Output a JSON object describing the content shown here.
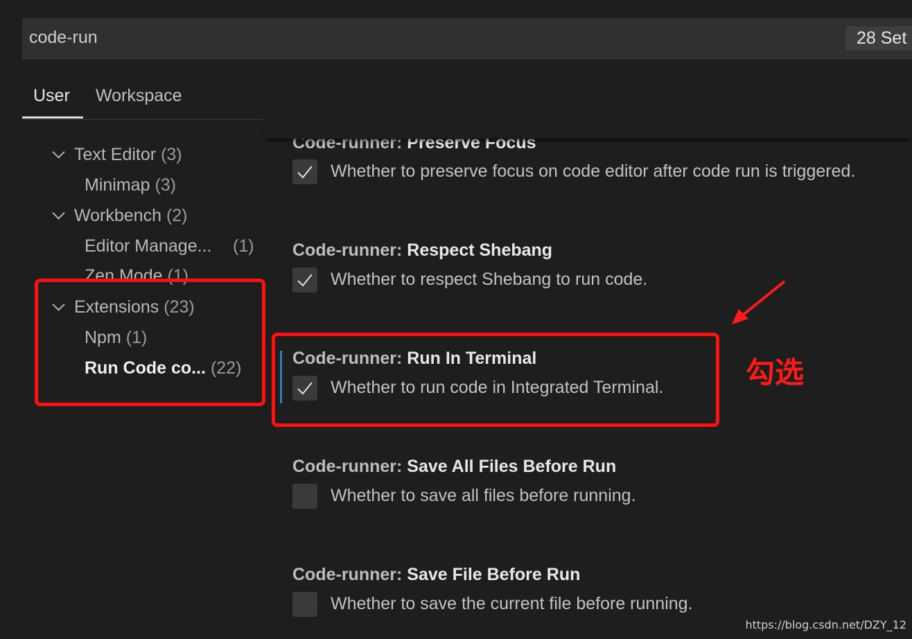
{
  "search": {
    "value": "code-run",
    "result_count": "28 Set"
  },
  "tabs": [
    {
      "label": "User"
    },
    {
      "label": "Workspace"
    }
  ],
  "toc": {
    "items": [
      {
        "label": "Text Editor",
        "count": "(3)"
      },
      {
        "label": "Minimap",
        "count": "(3)"
      },
      {
        "label": "Workbench",
        "count": "(2)"
      },
      {
        "label": "Editor Manage...",
        "count": "(1)"
      },
      {
        "label": "Zen Mode",
        "count": "(1)"
      },
      {
        "label": "Extensions",
        "count": "(23)"
      },
      {
        "label": "Npm",
        "count": "(1)"
      },
      {
        "label": "Run Code co...",
        "count": "(22)"
      }
    ]
  },
  "settings": [
    {
      "prefix": "Code-runner: ",
      "name": "Preserve Focus",
      "description": "Whether to preserve focus on code editor after code run is triggered.",
      "checked": true
    },
    {
      "prefix": "Code-runner: ",
      "name": "Respect Shebang",
      "description": "Whether to respect Shebang to run code.",
      "checked": true
    },
    {
      "prefix": "Code-runner: ",
      "name": "Run In Terminal",
      "description": "Whether to run code in Integrated Terminal.",
      "checked": true
    },
    {
      "prefix": "Code-runner: ",
      "name": "Save All Files Before Run",
      "description": "Whether to save all files before running.",
      "checked": false
    },
    {
      "prefix": "Code-runner: ",
      "name": "Save File Before Run",
      "description": "Whether to save the current file before running.",
      "checked": false
    }
  ],
  "annotation": {
    "text": "勾选",
    "color": "#ff1a1a"
  },
  "watermark": "https://blog.csdn.net/DZY_12",
  "colors": {
    "background": "#1e1e1e",
    "focus_accent": "#2f7fbf"
  }
}
